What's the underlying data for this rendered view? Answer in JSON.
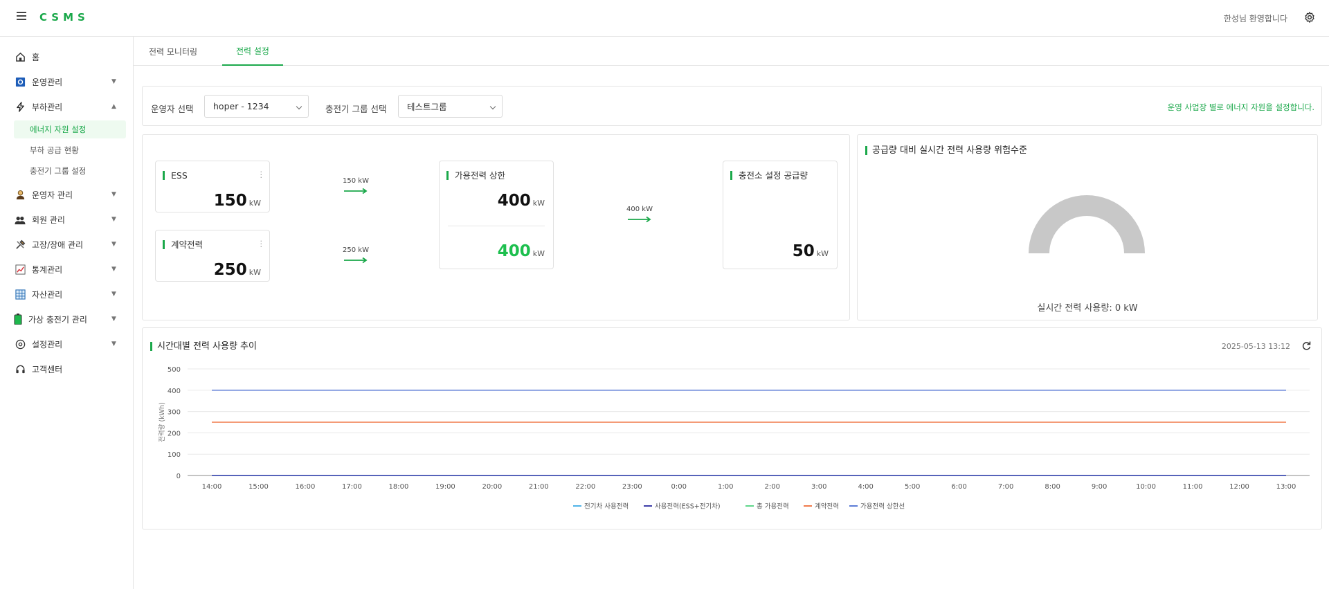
{
  "header": {
    "logo": "CSMS",
    "welcome": "한성님 환영합니다",
    "icons": [
      "hamburger-icon",
      "gear-icon"
    ]
  },
  "sidebar": {
    "items": [
      {
        "label": "홈",
        "icon": "home-icon"
      },
      {
        "label": "운영관리",
        "icon": "operation-icon"
      },
      {
        "label": "부하관리",
        "icon": "lightning-icon",
        "expanded": true
      },
      {
        "label": "운영자 관리",
        "icon": "operator-icon"
      },
      {
        "label": "회원 관리",
        "icon": "member-icon"
      },
      {
        "label": "고장/장애 관리",
        "icon": "tools-icon"
      },
      {
        "label": "통계관리",
        "icon": "stats-icon"
      },
      {
        "label": "자산관리",
        "icon": "asset-icon"
      },
      {
        "label": "가상 충전기 관리",
        "icon": "battery-icon"
      },
      {
        "label": "설정관리",
        "icon": "settings-icon"
      },
      {
        "label": "고객센터",
        "icon": "headset-icon"
      }
    ],
    "subitems": [
      {
        "label": "에너지 자원 설정",
        "active": true
      },
      {
        "label": "부하 공급 현황"
      },
      {
        "label": "충전기 그룹 설정"
      }
    ]
  },
  "tabs": [
    {
      "label": "전력 모니터링"
    },
    {
      "label": "전력 설정",
      "active": true
    }
  ],
  "filters": {
    "operator_label": "운영자 선택",
    "operator_value": "hoper - 1234",
    "group_label": "충전기 그룹 선택",
    "group_value": "테스트그룹",
    "note": "운영 사업장 별로 에너지 자원을 설정합니다."
  },
  "flow": {
    "ess": {
      "title": "ESS",
      "value": "150",
      "unit": "kW"
    },
    "contract": {
      "title": "계약전력",
      "value": "250",
      "unit": "kW"
    },
    "ess_arrow": "150 kW",
    "contract_arrow": "250 kW",
    "capacity": {
      "title": "가용전력 상한",
      "value": "400",
      "unit": "kW",
      "value2": "400",
      "unit2": "kW"
    },
    "capacity_arrow": "400 kW",
    "station": {
      "title": "충전소 설정 공급량",
      "value": "50",
      "unit": "kW"
    }
  },
  "gauge": {
    "title": "공급량 대비 실시간 전력 사용량 위험수준",
    "caption": "실시간 전력 사용량: 0 kW",
    "percent": 0,
    "track_color": "#c8c8c8"
  },
  "trend": {
    "title": "시간대별 전력 사용량 추이",
    "timestamp": "2025-05-13 13:12"
  },
  "chart_data": {
    "type": "line",
    "ylabel": "전력량 (kWh)",
    "ylim": [
      0,
      500
    ],
    "yticks": [
      0,
      100,
      200,
      300,
      400,
      500
    ],
    "grid": true,
    "legend_position": "bottom",
    "categories": [
      "14:00",
      "15:00",
      "16:00",
      "17:00",
      "18:00",
      "19:00",
      "20:00",
      "21:00",
      "22:00",
      "23:00",
      "0:00",
      "1:00",
      "2:00",
      "3:00",
      "4:00",
      "5:00",
      "6:00",
      "7:00",
      "8:00",
      "9:00",
      "10:00",
      "11:00",
      "12:00",
      "13:00"
    ],
    "series": [
      {
        "name": "전기차 사용전력",
        "color": "#4fb3e8",
        "values": [
          0,
          0,
          0,
          0,
          0,
          0,
          0,
          0,
          0,
          0,
          0,
          0,
          0,
          0,
          0,
          0,
          0,
          0,
          0,
          0,
          0,
          0,
          0,
          0
        ]
      },
      {
        "name": "사용전력(ESS+전기차)",
        "color": "#3c3ca8",
        "values": [
          0,
          0,
          0,
          0,
          0,
          0,
          0,
          0,
          0,
          0,
          0,
          0,
          0,
          0,
          0,
          0,
          0,
          0,
          0,
          0,
          0,
          0,
          0,
          0
        ]
      },
      {
        "name": "총 가용전력",
        "color": "#5fd68a",
        "values": [
          400,
          400,
          400,
          400,
          400,
          400,
          400,
          400,
          400,
          400,
          400,
          400,
          400,
          400,
          400,
          400,
          400,
          400,
          400,
          400,
          400,
          400,
          400,
          400
        ]
      },
      {
        "name": "계약전력",
        "color": "#f07a4a",
        "values": [
          250,
          250,
          250,
          250,
          250,
          250,
          250,
          250,
          250,
          250,
          250,
          250,
          250,
          250,
          250,
          250,
          250,
          250,
          250,
          250,
          250,
          250,
          250,
          250
        ]
      },
      {
        "name": "가용전력 상한선",
        "color": "#5b7bd6",
        "values": [
          400,
          400,
          400,
          400,
          400,
          400,
          400,
          400,
          400,
          400,
          400,
          400,
          400,
          400,
          400,
          400,
          400,
          400,
          400,
          400,
          400,
          400,
          400,
          400
        ]
      }
    ]
  }
}
